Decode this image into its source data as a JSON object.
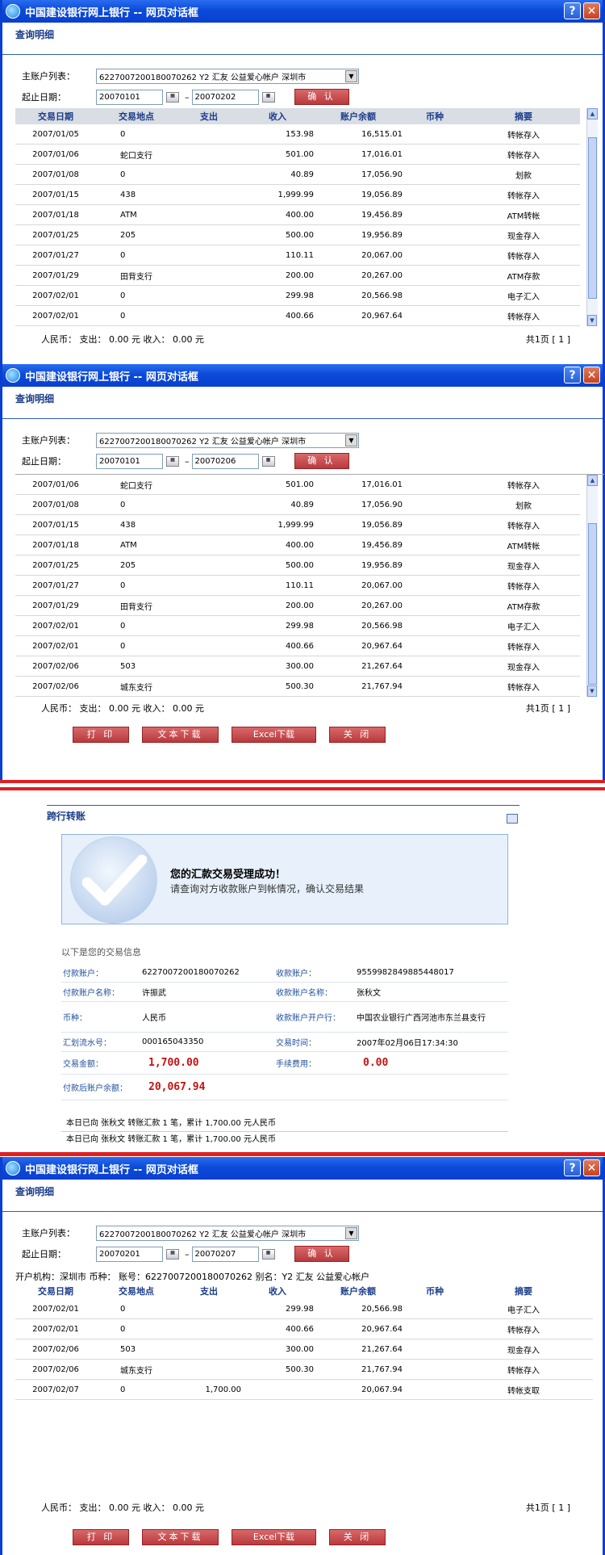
{
  "dialog_title": "中国建设银行网上银行 -- 网页对话框",
  "help_glyph": "?",
  "close_glyph": "✕",
  "subtitle": "查询明细",
  "form": {
    "account_label": "主账户列表：",
    "account_value": "6227007200180070262    Y2 汇友 公益爱心帐户   深圳市",
    "date_label": "起止日期：",
    "confirm_label": "确 认"
  },
  "columns": [
    "交易日期",
    "交易地点",
    "支出",
    "收入",
    "账户余额",
    "币种",
    "摘要"
  ],
  "windows": [
    {
      "start_date": "20070101",
      "end_date": "20070202",
      "rows": [
        {
          "date": "2007/01/05",
          "place": "0",
          "out": "",
          "in": "153.98",
          "bal": "16,515.01",
          "cur": "",
          "memo": "转帐存入"
        },
        {
          "date": "2007/01/06",
          "place": "蛇口支行",
          "out": "",
          "in": "501.00",
          "bal": "17,016.01",
          "cur": "",
          "memo": "转帐存入"
        },
        {
          "date": "2007/01/08",
          "place": "0",
          "out": "",
          "in": "40.89",
          "bal": "17,056.90",
          "cur": "",
          "memo": "划款"
        },
        {
          "date": "2007/01/15",
          "place": "438",
          "out": "",
          "in": "1,999.99",
          "bal": "19,056.89",
          "cur": "",
          "memo": "转帐存入"
        },
        {
          "date": "2007/01/18",
          "place": "ATM",
          "out": "",
          "in": "400.00",
          "bal": "19,456.89",
          "cur": "",
          "memo": "ATM转帐"
        },
        {
          "date": "2007/01/25",
          "place": "205",
          "out": "",
          "in": "500.00",
          "bal": "19,956.89",
          "cur": "",
          "memo": "现金存入"
        },
        {
          "date": "2007/01/27",
          "place": "0",
          "out": "",
          "in": "110.11",
          "bal": "20,067.00",
          "cur": "",
          "memo": "转帐存入"
        },
        {
          "date": "2007/01/29",
          "place": "田背支行",
          "out": "",
          "in": "200.00",
          "bal": "20,267.00",
          "cur": "",
          "memo": "ATM存款"
        },
        {
          "date": "2007/02/01",
          "place": "0",
          "out": "",
          "in": "299.98",
          "bal": "20,566.98",
          "cur": "",
          "memo": "电子汇入"
        },
        {
          "date": "2007/02/01",
          "place": "0",
          "out": "",
          "in": "400.66",
          "bal": "20,967.64",
          "cur": "",
          "memo": "转帐存入"
        }
      ],
      "footer": "人民币：  支出：  0.00 元   收入：  0.00 元",
      "pager": "共1页   [ 1 ]"
    },
    {
      "start_date": "20070101",
      "end_date": "20070206",
      "rows": [
        {
          "date": "2007/01/06",
          "place": "蛇口支行",
          "out": "",
          "in": "501.00",
          "bal": "17,016.01",
          "cur": "",
          "memo": "转帐存入"
        },
        {
          "date": "2007/01/08",
          "place": "0",
          "out": "",
          "in": "40.89",
          "bal": "17,056.90",
          "cur": "",
          "memo": "划款"
        },
        {
          "date": "2007/01/15",
          "place": "438",
          "out": "",
          "in": "1,999.99",
          "bal": "19,056.89",
          "cur": "",
          "memo": "转帐存入"
        },
        {
          "date": "2007/01/18",
          "place": "ATM",
          "out": "",
          "in": "400.00",
          "bal": "19,456.89",
          "cur": "",
          "memo": "ATM转帐"
        },
        {
          "date": "2007/01/25",
          "place": "205",
          "out": "",
          "in": "500.00",
          "bal": "19,956.89",
          "cur": "",
          "memo": "现金存入"
        },
        {
          "date": "2007/01/27",
          "place": "0",
          "out": "",
          "in": "110.11",
          "bal": "20,067.00",
          "cur": "",
          "memo": "转帐存入"
        },
        {
          "date": "2007/01/29",
          "place": "田背支行",
          "out": "",
          "in": "200.00",
          "bal": "20,267.00",
          "cur": "",
          "memo": "ATM存款"
        },
        {
          "date": "2007/02/01",
          "place": "0",
          "out": "",
          "in": "299.98",
          "bal": "20,566.98",
          "cur": "",
          "memo": "电子汇入"
        },
        {
          "date": "2007/02/01",
          "place": "0",
          "out": "",
          "in": "400.66",
          "bal": "20,967.64",
          "cur": "",
          "memo": "转帐存入"
        },
        {
          "date": "2007/02/06",
          "place": "503",
          "out": "",
          "in": "300.00",
          "bal": "21,267.64",
          "cur": "",
          "memo": "现金存入"
        },
        {
          "date": "2007/02/06",
          "place": "城东支行",
          "out": "",
          "in": "500.30",
          "bal": "21,767.94",
          "cur": "",
          "memo": "转帐存入"
        }
      ],
      "footer": "人民币：  支出：  0.00 元   收入：  0.00 元",
      "pager": "共1页   [ 1 ]"
    },
    {
      "start_date": "20070201",
      "end_date": "20070207",
      "account_info": "开户机构：深圳市 币种：  账号：6227007200180070262 别名：Y2 汇友 公益爱心帐户",
      "rows": [
        {
          "date": "2007/02/01",
          "place": "0",
          "out": "",
          "in": "299.98",
          "bal": "20,566.98",
          "cur": "",
          "memo": "电子汇入"
        },
        {
          "date": "2007/02/01",
          "place": "0",
          "out": "",
          "in": "400.66",
          "bal": "20,967.64",
          "cur": "",
          "memo": "转帐存入"
        },
        {
          "date": "2007/02/06",
          "place": "503",
          "out": "",
          "in": "300.00",
          "bal": "21,267.64",
          "cur": "",
          "memo": "现金存入"
        },
        {
          "date": "2007/02/06",
          "place": "城东支行",
          "out": "",
          "in": "500.30",
          "bal": "21,767.94",
          "cur": "",
          "memo": "转帐存入"
        },
        {
          "date": "2007/02/07",
          "place": "0",
          "out": "1,700.00",
          "in": "",
          "bal": "20,067.94",
          "cur": "",
          "memo": "转帐支取"
        }
      ],
      "footer": "人民币：  支出：  0.00 元   收入：  0.00 元",
      "pager": "共1页   [ 1 ]"
    }
  ],
  "buttons": {
    "print": "打 印",
    "text_download": "文本下载",
    "excel_download": "Excel下载",
    "close": "关 闭"
  },
  "transfer": {
    "header": "跨行转账",
    "success_title": "您的汇款交易受理成功！",
    "success_sub": "请查询对方收款账户到帐情况，确认交易结果",
    "info_title": "以下是您的交易信息",
    "fields": [
      {
        "k1": "付款账户：",
        "v1": "6227007200180070262",
        "k2": "收款账户：",
        "v2": "9559982849885448017"
      },
      {
        "k1": "付款账户名称：",
        "v1": "许振武",
        "k2": "收款账户名称：",
        "v2": "张秋文"
      },
      {
        "k1": "币种：",
        "v1": "人民币",
        "k2": "收款账户开户行：",
        "v2": "中国农业银行广西河池市东兰县支行"
      },
      {
        "k1": "汇划流水号：",
        "v1": "000165043350",
        "k2": "交易时间：",
        "v2": "2007年02月06日17:34:30"
      }
    ],
    "amount_label": "交易金额：",
    "amount": "1,700.00",
    "fee_label": "手续费用：",
    "fee": "0.00",
    "balance_label": "付款后账户余额：",
    "balance": "20,067.94",
    "summary1": "本日已向 张秋文 转账汇款 1 笔，累计 1,700.00 元人民币",
    "summary2": "本日已向 张秋文 转账汇款 1 笔，累计 1,700.00 元人民币"
  }
}
